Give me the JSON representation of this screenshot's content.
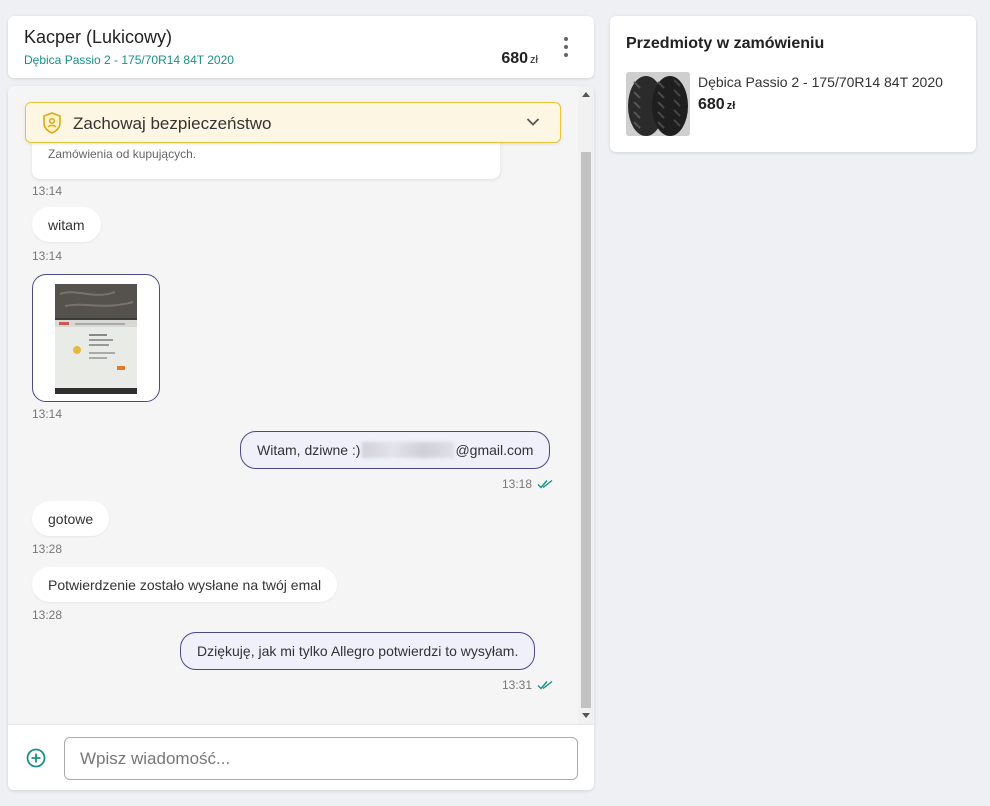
{
  "header": {
    "contact_name": "Kacper (Lukicowy)",
    "offer_title": "Dębica Passio 2 - 175/70R14 84T 2020",
    "price": "680",
    "currency": "zł"
  },
  "safety_banner": {
    "label": "Zachowaj bezpieczeństwo"
  },
  "messages": {
    "system_card_text": "Zamówienia od kupujących.",
    "items": [
      {
        "direction": "system",
        "time": "13:14"
      },
      {
        "direction": "incoming",
        "text": "witam",
        "time": "13:14"
      },
      {
        "direction": "incoming",
        "type": "image",
        "time": "13:14"
      },
      {
        "direction": "outgoing",
        "text_prefix": "Witam, dziwne :)",
        "text_suffix": "@gmail.com",
        "time": "13:18",
        "status": "read"
      },
      {
        "direction": "incoming",
        "text": "gotowe",
        "time": "13:28"
      },
      {
        "direction": "incoming",
        "text": "Potwierdzenie zostało wysłane na twój emal",
        "time": "13:28"
      },
      {
        "direction": "outgoing",
        "text": "Dziękuję, jak mi tylko Allegro potwierdzi to wysyłam.",
        "time": "13:31",
        "status": "read"
      }
    ]
  },
  "composer": {
    "placeholder": "Wpisz wiadomość...",
    "value": ""
  },
  "order_items": {
    "title": "Przedmioty w zamówieniu",
    "items": [
      {
        "name": "Dębica Passio 2 - 175/70R14 84T 2020",
        "price": "680",
        "currency": "zł"
      }
    ]
  },
  "colors": {
    "accent_teal": "#1a8f84",
    "outgoing_border": "#4a4a8a",
    "warning_border": "#e6c53a",
    "warning_bg": "#fdf6e3"
  },
  "icons": {
    "header_menu": "more-vertical-icon",
    "banner": "shield-user-icon",
    "banner_toggle": "chevron-down-icon",
    "read_status": "double-check-icon",
    "attach": "plus-circle-icon"
  }
}
